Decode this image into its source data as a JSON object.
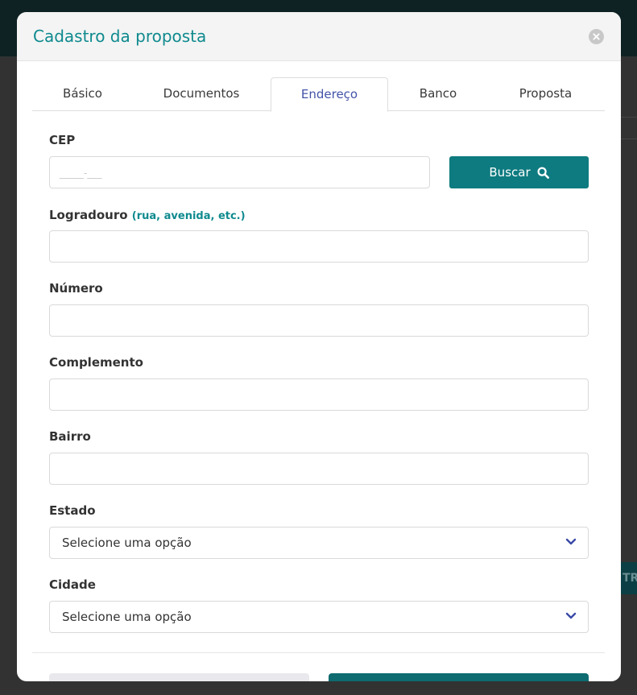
{
  "background": {
    "partial_button_text": "TR"
  },
  "modal": {
    "title": "Cadastro da proposta",
    "close_icon": "close-circle-icon"
  },
  "tabs": [
    {
      "label": "Básico",
      "active": false
    },
    {
      "label": "Documentos",
      "active": false
    },
    {
      "label": "Endereço",
      "active": true
    },
    {
      "label": "Banco",
      "active": false
    },
    {
      "label": "Proposta",
      "active": false
    }
  ],
  "form": {
    "cep": {
      "label": "CEP",
      "placeholder": "_____-___",
      "value": ""
    },
    "search_button": {
      "label": "Buscar",
      "icon": "search-icon"
    },
    "logradouro": {
      "label": "Logradouro",
      "hint": "(rua, avenida, etc.)",
      "value": ""
    },
    "numero": {
      "label": "Número",
      "value": ""
    },
    "complemento": {
      "label": "Complemento",
      "value": ""
    },
    "bairro": {
      "label": "Bairro",
      "value": ""
    },
    "estado": {
      "label": "Estado",
      "selected": "Selecione uma opção"
    },
    "cidade": {
      "label": "Cidade",
      "selected": "Selecione uma opção"
    }
  },
  "colors": {
    "accent": "#0f8a8e",
    "primary_button": "#0e7b80",
    "active_tab_text": "#4253a8"
  }
}
